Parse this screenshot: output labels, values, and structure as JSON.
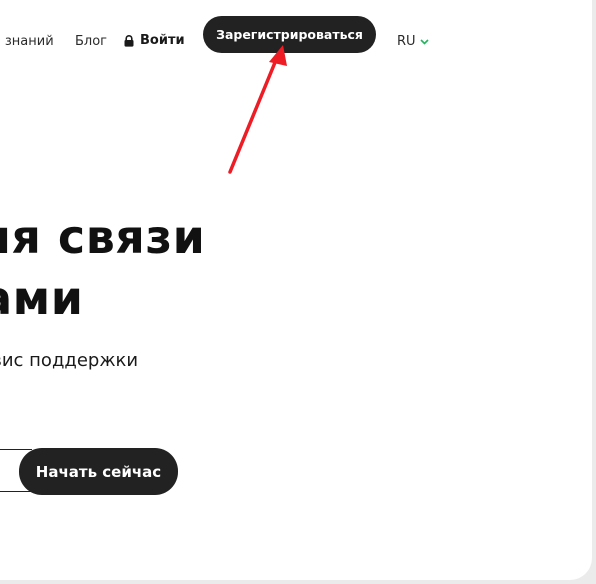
{
  "header": {
    "nav": {
      "knowledge_base": "База знаний",
      "blog": "Блог"
    },
    "login_label": "Войти",
    "register_label": "Зарегистрироваться",
    "language": "RU"
  },
  "hero": {
    "title_line1": "Все для связи",
    "title_line2": "с клиентами",
    "subtitle": "Облачный сервис поддержки"
  },
  "cta": {
    "email_placeholder": "",
    "start_label": "Начать сейчас"
  },
  "icons": {
    "lock": "lock-icon",
    "chevron": "chevron-down-icon"
  },
  "colors": {
    "button_bg": "#222222",
    "button_text": "#ffffff",
    "accent_green": "#22b35e",
    "annotation_arrow": "#ee1c24"
  }
}
